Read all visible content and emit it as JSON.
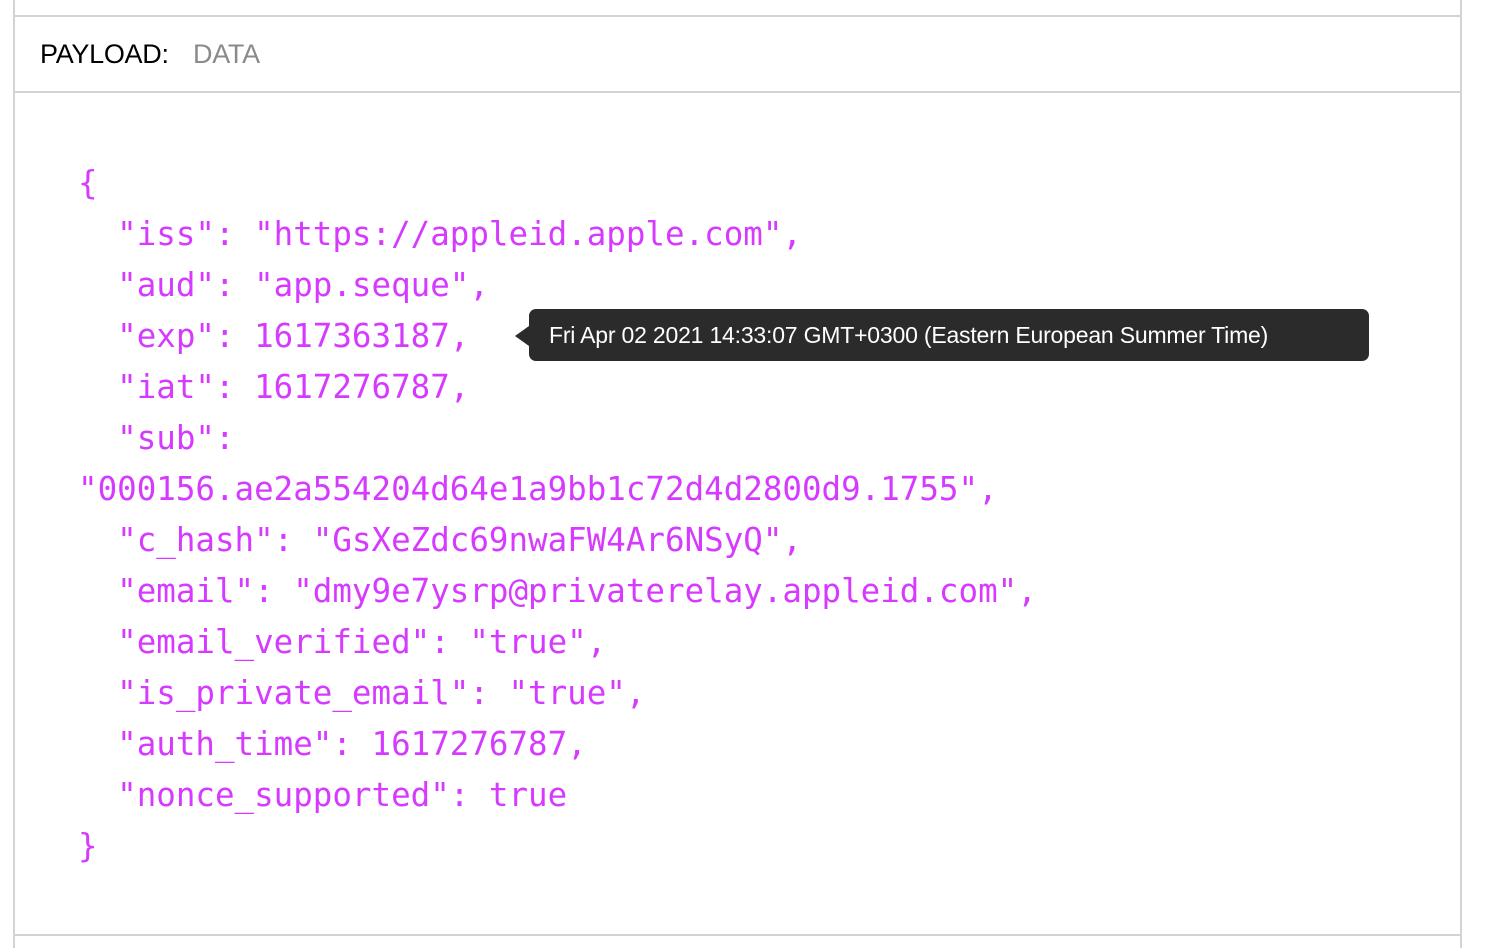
{
  "section": {
    "title": "PAYLOAD:",
    "subtitle": "DATA"
  },
  "code_lines": [
    "{",
    "  \"iss\": \"https://appleid.apple.com\",",
    "  \"aud\": \"app.seque\",",
    "  \"exp\": 1617363187,",
    "  \"iat\": 1617276787,",
    "  \"sub\":",
    "\"000156.ae2a554204d64e1a9bb1c72d4d2800d9.1755\",",
    "  \"c_hash\": \"GsXeZdc69nwaFW4Ar6NSyQ\",",
    "  \"email\": \"dmy9e7ysrp@privaterelay.appleid.com\",",
    "  \"email_verified\": \"true\",",
    "  \"is_private_email\": \"true\",",
    "  \"auth_time\": 1617276787,",
    "  \"nonce_supported\": true",
    "}"
  ],
  "tooltip": {
    "text": "Fri Apr 02 2021 14:33:07 GMT+0300 (Eastern European Summer Time)"
  },
  "colors": {
    "code": "#d63aff",
    "tooltip_bg": "#2b2b2b",
    "border": "#d3d3d3"
  }
}
